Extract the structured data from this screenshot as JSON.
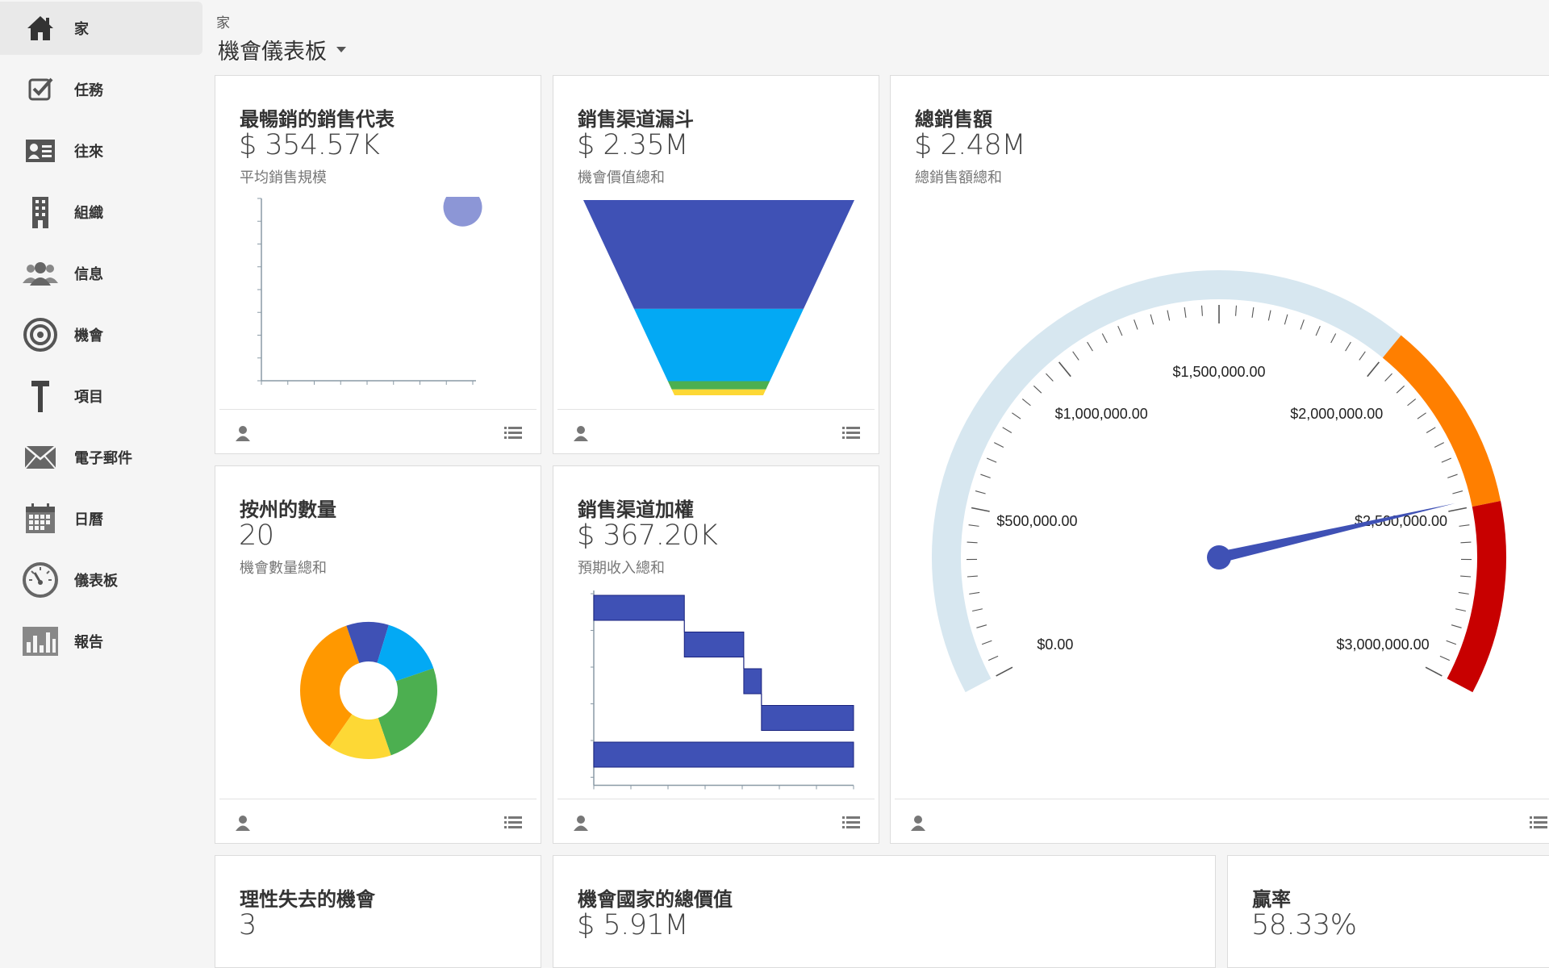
{
  "nav": {
    "items": [
      {
        "label": "家",
        "icon": "home-icon"
      },
      {
        "label": "任務",
        "icon": "task-icon"
      },
      {
        "label": "往來",
        "icon": "contact-card-icon"
      },
      {
        "label": "組織",
        "icon": "building-icon"
      },
      {
        "label": "信息",
        "icon": "people-icon"
      },
      {
        "label": "機會",
        "icon": "target-icon"
      },
      {
        "label": "項目",
        "icon": "hammer-icon"
      },
      {
        "label": "電子郵件",
        "icon": "envelope-icon"
      },
      {
        "label": "日曆",
        "icon": "calendar-icon"
      },
      {
        "label": "儀表板",
        "icon": "dashboard-icon"
      },
      {
        "label": "報告",
        "icon": "bar-chart-icon"
      }
    ]
  },
  "header": {
    "breadcrumb": "家",
    "title": "機會儀表板"
  },
  "cards": {
    "top_rep": {
      "title": "最暢銷的銷售代表",
      "value": "$ 354.57K",
      "subtitle": "平均銷售規模"
    },
    "funnel": {
      "title": "銷售渠道漏斗",
      "value": "$ 2.35M",
      "subtitle": "機會價值總和"
    },
    "total_sales": {
      "title": "總銷售額",
      "value": "$ 2.48M",
      "subtitle": "總銷售額總和"
    },
    "by_state": {
      "title": "按州的數量",
      "value": "20",
      "subtitle": "機會數量總和"
    },
    "weighted": {
      "title": "銷售渠道加權",
      "value": "$ 367.20K",
      "subtitle": "預期收入總和"
    },
    "lost": {
      "title": "理性失去的機會",
      "value": "3"
    },
    "by_country": {
      "title": "機會國家的總價值",
      "value": "$ 5.91M"
    },
    "win_rate": {
      "title": "贏率",
      "value": "58.33%"
    }
  },
  "colors": {
    "indigo": "#3f51b5",
    "sky": "#03a9f4",
    "green": "#4caf50",
    "yellow": "#fdd835",
    "orange": "#ff9800",
    "gauge_band": "#d7e7f0",
    "gauge_orange": "#ff7f00",
    "gauge_red": "#c80000"
  },
  "chart_data": [
    {
      "type": "scatter",
      "points": [
        {
          "x": 8,
          "y": 10
        }
      ],
      "xlim": [
        0,
        8.4
      ],
      "ylim": [
        0,
        10.5
      ]
    },
    {
      "type": "funnel",
      "stages": [
        {
          "value": 1.31,
          "color": "#3f51b5"
        },
        {
          "value": 0.87,
          "color": "#03a9f4"
        },
        {
          "value": 0.1,
          "color": "#4caf50"
        },
        {
          "value": 0.07,
          "color": "#fdd835"
        }
      ]
    },
    {
      "type": "gauge",
      "value": 2480000,
      "min": 0,
      "max": 3000000,
      "tick_labels": [
        "$0.00",
        "$500,000.00",
        "$1,000,000.00",
        "$1,500,000.00",
        "$2,000,000.00",
        "$2,500,000.00",
        "$3,000,000.00"
      ],
      "bands": [
        {
          "from": 0,
          "to": 2000000,
          "color": "#d7e7f0"
        },
        {
          "from": 2000000,
          "to": 2500000,
          "color": "#ff7f00"
        },
        {
          "from": 2500000,
          "to": 3000000,
          "color": "#c80000"
        }
      ]
    },
    {
      "type": "pie",
      "donut": true,
      "slices": [
        {
          "value": 7,
          "color": "#ff9800"
        },
        {
          "value": 2,
          "color": "#3f51b5"
        },
        {
          "value": 3,
          "color": "#03a9f4"
        },
        {
          "value": 5,
          "color": "#4caf50"
        },
        {
          "value": 3,
          "color": "#fdd835"
        }
      ]
    },
    {
      "type": "bar",
      "subtype": "waterfall",
      "steps": [
        {
          "start": 0,
          "end": 128,
          "total": false
        },
        {
          "start": 128,
          "end": 212,
          "total": false
        },
        {
          "start": 212,
          "end": 237,
          "total": false
        },
        {
          "start": 237,
          "end": 367.2,
          "total": false
        },
        {
          "start": 0,
          "end": 367.2,
          "total": true
        }
      ],
      "xlim": [
        0,
        367.2
      ]
    }
  ]
}
